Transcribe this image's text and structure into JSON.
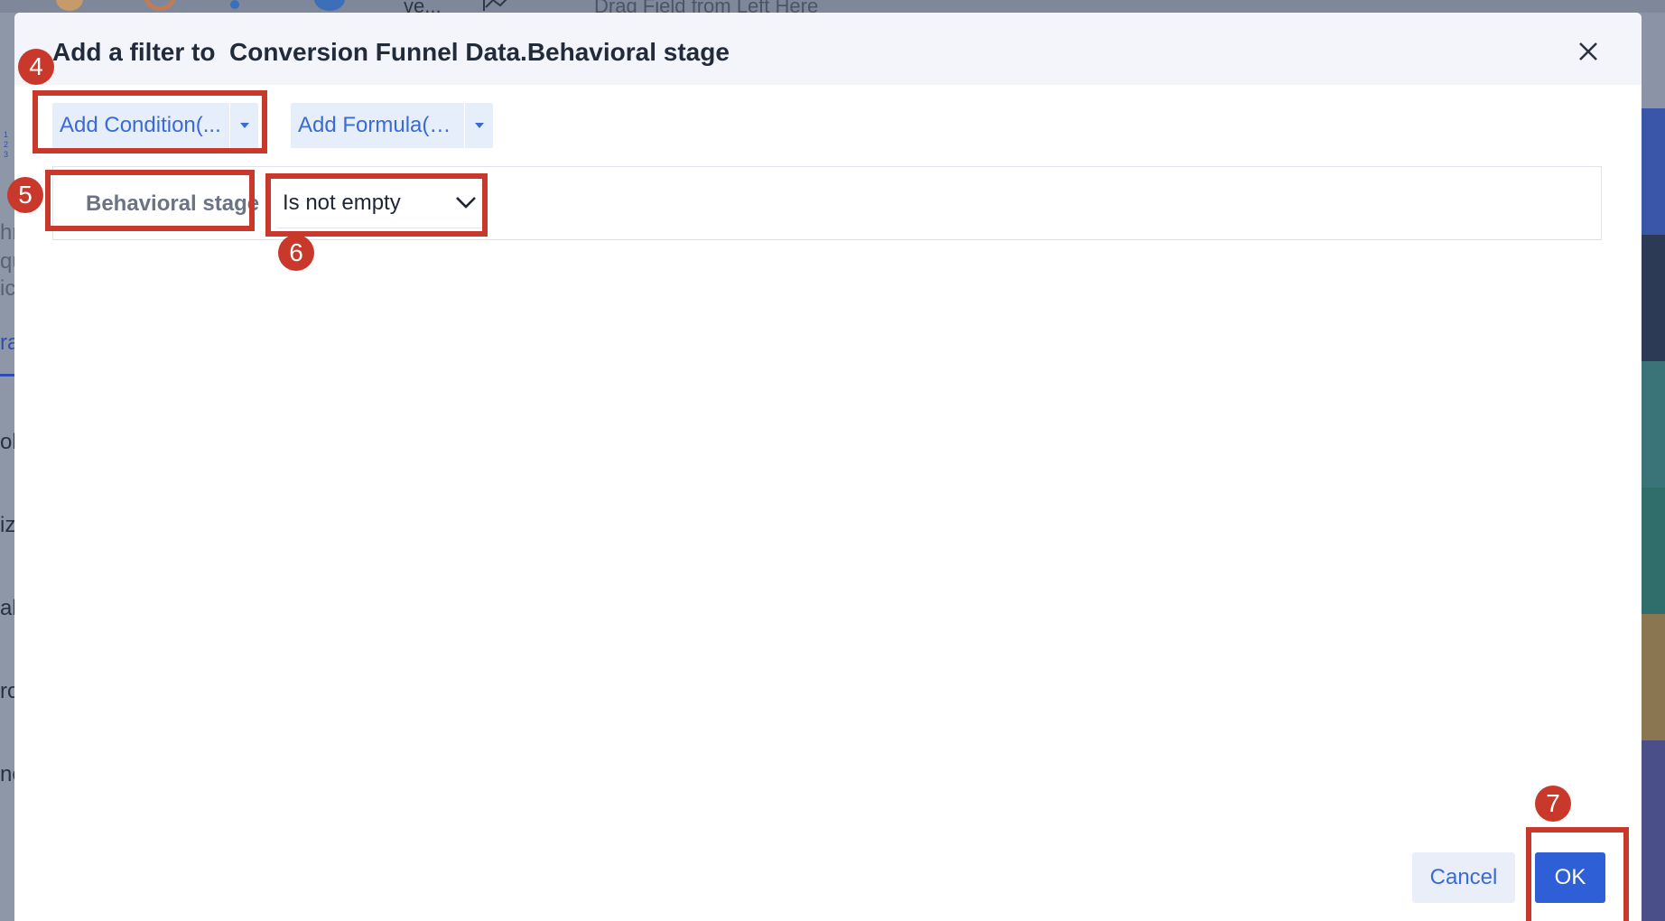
{
  "background": {
    "hint_text": "Drag Field from Left Here",
    "chart_label": "ve...",
    "left_fragments": [
      "hr",
      "qu",
      "ic",
      "ra",
      "ol",
      "iz",
      "ab",
      "ro",
      "ne"
    ]
  },
  "dialog": {
    "title": "Add a filter to  Conversion Funnel Data.Behavioral stage",
    "add_condition_label": "Add Condition(...",
    "add_formula_label": "Add Formula(A...",
    "condition": {
      "field": "Behavioral stage",
      "operator": "Is not empty"
    },
    "cancel_label": "Cancel",
    "ok_label": "OK"
  },
  "annotations": {
    "badges": [
      "4",
      "5",
      "6",
      "7"
    ]
  },
  "colors": {
    "accent": "#2f5fd6",
    "annotation": "#c8382b",
    "link_text": "#3a6ad6"
  }
}
